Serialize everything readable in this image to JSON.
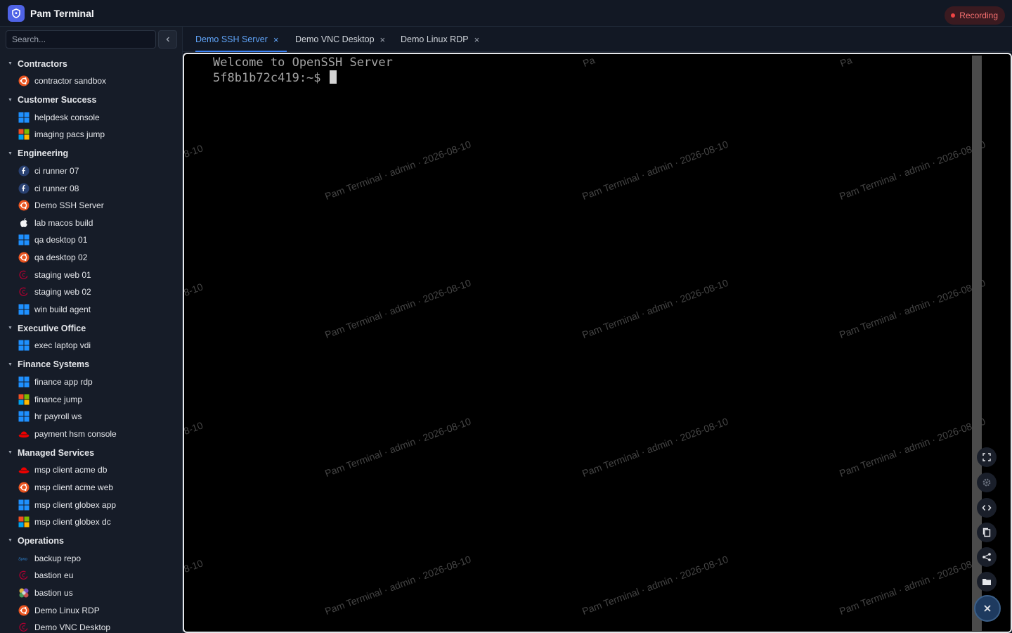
{
  "app": {
    "title": "Pam Terminal",
    "recording_label": "Recording"
  },
  "search": {
    "placeholder": "Search...",
    "collapse_icon": "chevron-left-icon"
  },
  "groups": [
    {
      "name": "Contractors",
      "hosts": [
        {
          "label": "contractor sandbox",
          "os": "ubuntu"
        }
      ]
    },
    {
      "name": "Customer Success",
      "hosts": [
        {
          "label": "helpdesk console",
          "os": "windows"
        },
        {
          "label": "imaging pacs jump",
          "os": "windows-legacy"
        }
      ]
    },
    {
      "name": "Engineering",
      "hosts": [
        {
          "label": "ci runner 07",
          "os": "fedora"
        },
        {
          "label": "ci runner 08",
          "os": "fedora"
        },
        {
          "label": "Demo SSH Server",
          "os": "ubuntu"
        },
        {
          "label": "lab macos build",
          "os": "apple"
        },
        {
          "label": "qa desktop 01",
          "os": "windows"
        },
        {
          "label": "qa desktop 02",
          "os": "ubuntu"
        },
        {
          "label": "staging web 01",
          "os": "debian"
        },
        {
          "label": "staging web 02",
          "os": "debian"
        },
        {
          "label": "win build agent",
          "os": "windows"
        }
      ]
    },
    {
      "name": "Executive Office",
      "hosts": [
        {
          "label": "exec laptop vdi",
          "os": "windows"
        }
      ]
    },
    {
      "name": "Finance Systems",
      "hosts": [
        {
          "label": "finance app rdp",
          "os": "windows"
        },
        {
          "label": "finance jump",
          "os": "windows-legacy"
        },
        {
          "label": "hr payroll ws",
          "os": "windows"
        },
        {
          "label": "payment hsm console",
          "os": "redhat"
        }
      ]
    },
    {
      "name": "Managed Services",
      "hosts": [
        {
          "label": "msp client acme db",
          "os": "redhat"
        },
        {
          "label": "msp client acme web",
          "os": "ubuntu"
        },
        {
          "label": "msp client globex app",
          "os": "windows"
        },
        {
          "label": "msp client globex dc",
          "os": "windows-legacy"
        }
      ]
    },
    {
      "name": "Operations",
      "hosts": [
        {
          "label": "backup repo",
          "os": "synology"
        },
        {
          "label": "bastion eu",
          "os": "debian"
        },
        {
          "label": "bastion us",
          "os": "linux"
        },
        {
          "label": "Demo Linux RDP",
          "os": "ubuntu"
        },
        {
          "label": "Demo VNC Desktop",
          "os": "debian"
        }
      ]
    }
  ],
  "tabs": [
    {
      "label": "Demo SSH Server",
      "active": true
    },
    {
      "label": "Demo VNC Desktop",
      "active": false
    },
    {
      "label": "Demo Linux RDP",
      "active": false
    }
  ],
  "terminal": {
    "line1": "Welcome to OpenSSH Server",
    "prompt": "5f8b1b72c419:~$ ",
    "watermark": "Pam Terminal · admin · 2026-08-10",
    "watermark_partial_left": "8-10",
    "watermark_partial_top": "Pa"
  },
  "tools": [
    {
      "name": "fullscreen-icon"
    },
    {
      "name": "settings-icon"
    },
    {
      "name": "code-icon"
    },
    {
      "name": "copy-icon"
    },
    {
      "name": "share-icon"
    },
    {
      "name": "folder-icon"
    }
  ],
  "close_fab": {
    "icon": "close-icon"
  },
  "colors": {
    "accent": "#3b82f6",
    "logo": "#4f63e6",
    "recording": "#ef4444",
    "ubuntu": "#e95420",
    "windows": "#1e90ff",
    "redhat": "#ee0000",
    "debian": "#a80030"
  }
}
